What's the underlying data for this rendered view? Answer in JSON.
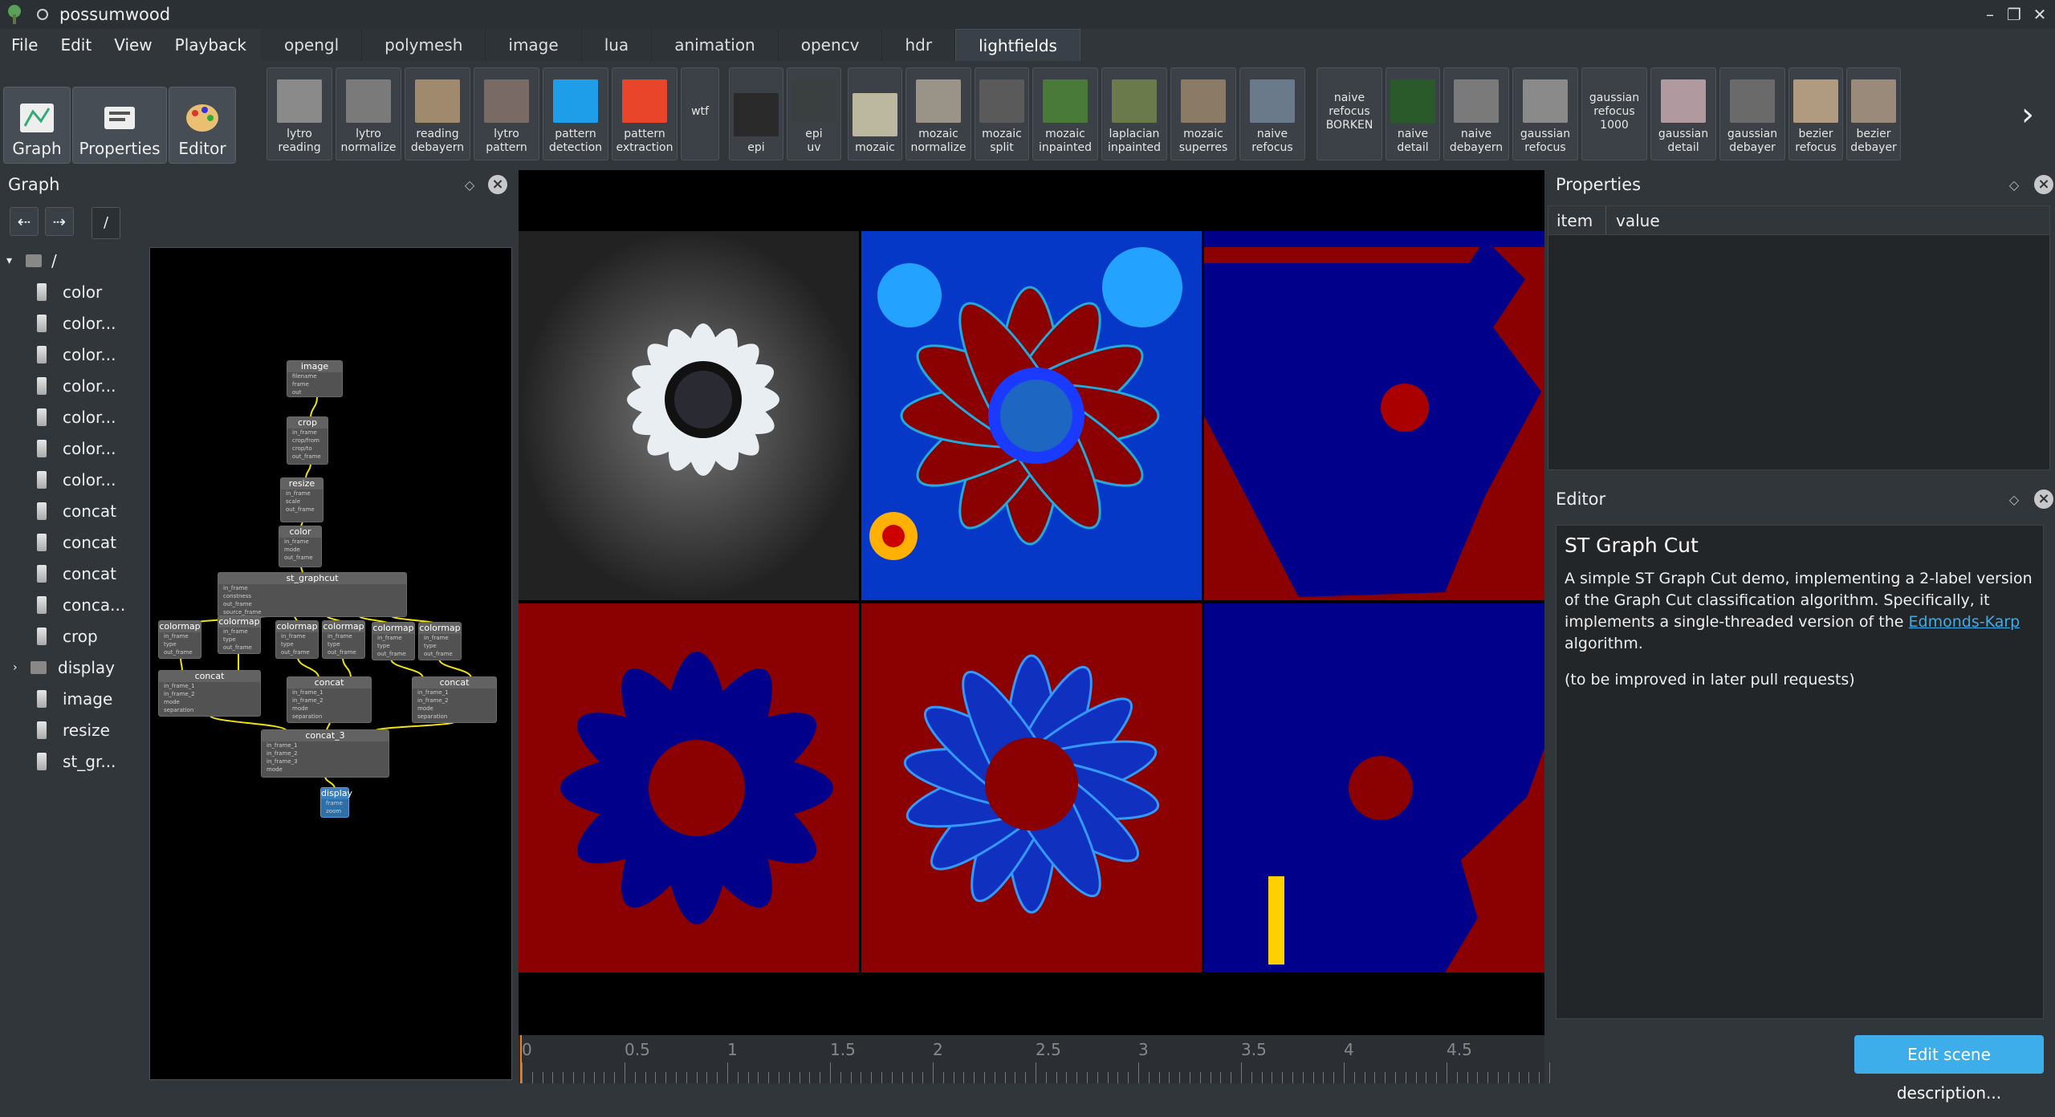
{
  "window": {
    "title": "possumwood"
  },
  "menu": [
    "File",
    "Edit",
    "View",
    "Playback"
  ],
  "tabs": [
    "opengl",
    "polymesh",
    "image",
    "lua",
    "animation",
    "opencv",
    "hdr",
    "lightfields"
  ],
  "active_tab": "lightfields",
  "left_buttons": [
    "Graph",
    "Properties",
    "Editor"
  ],
  "examples": [
    {
      "label": "lytro\nreading",
      "thumb": "#8a8a8a"
    },
    {
      "label": "lytro\nnormalize",
      "thumb": "#7a7a7a"
    },
    {
      "label": "reading\ndebayern",
      "thumb": "#a08a6e"
    },
    {
      "label": "lytro\npattern",
      "thumb": "#7a6a66"
    },
    {
      "label": "pattern\ndetection",
      "thumb": "#1e9ee8"
    },
    {
      "label": "pattern\nextraction",
      "thumb": "#e8452a"
    },
    {
      "label": "wtf",
      "thumb": ""
    },
    {
      "label": "epi",
      "thumb": "#2a2a2a"
    },
    {
      "label": "epi\nuv",
      "thumb": "#3a4040"
    },
    {
      "label": "mozaic",
      "thumb": "#bcb8a0"
    },
    {
      "label": "mozaic\nnormalize",
      "thumb": "#9a9488"
    },
    {
      "label": "mozaic\nsplit",
      "thumb": "#5a5a5a"
    },
    {
      "label": "mozaic\ninpainted",
      "thumb": "#4a7a3a"
    },
    {
      "label": "laplacian\ninpainted",
      "thumb": "#6a7a4a"
    },
    {
      "label": "mozaic\nsuperres",
      "thumb": "#8a7a66"
    },
    {
      "label": "naive\nrefocus",
      "thumb": "#6a7a8a"
    },
    {
      "label": "naive\nrefocus\nBORKEN",
      "thumb": ""
    },
    {
      "label": "naive\ndetail",
      "thumb": "#2a5a2a"
    },
    {
      "label": "naive\ndebayern",
      "thumb": "#7a7a7a"
    },
    {
      "label": "gaussian\nrefocus",
      "thumb": "#8a8a8a"
    },
    {
      "label": "gaussian\nrefocus\n1000",
      "thumb": ""
    },
    {
      "label": "gaussian\ndetail",
      "thumb": "#b09aa0"
    },
    {
      "label": "gaussian\ndebayer",
      "thumb": "#6a6a6a"
    },
    {
      "label": "bezier\nrefocus",
      "thumb": "#b09a80"
    },
    {
      "label": "bezier\ndebayer",
      "thumb": "#9a8a7a"
    }
  ],
  "graph_panel": {
    "title": "Graph",
    "path": "/",
    "tree": [
      "/",
      "color",
      "color...",
      "color...",
      "color...",
      "color...",
      "color...",
      "color...",
      "concat",
      "concat",
      "concat",
      "conca...",
      "crop",
      "display",
      "image",
      "resize",
      "st_gr..."
    ]
  },
  "nodes": {
    "image": {
      "title": "image",
      "ports": [
        "filename",
        "frame",
        "out"
      ]
    },
    "crop": {
      "title": "crop",
      "ports": [
        "in_frame",
        "crop/from",
        "crop/to",
        "out_frame"
      ]
    },
    "resize": {
      "title": "resize",
      "ports": [
        "in_frame",
        "scale",
        "out_frame"
      ]
    },
    "color": {
      "title": "color",
      "ports": [
        "in_frame",
        "mode",
        "out_frame"
      ]
    },
    "graphcut": {
      "title": "st_graphcut",
      "ports": [
        "in_frame",
        "constness",
        "out_frame",
        "source_frame",
        "fsets_frame",
        "sum_frame",
        "sink_frame"
      ]
    },
    "colormap": {
      "title": "colormap",
      "ports": [
        "in_frame",
        "type",
        "out_frame"
      ]
    },
    "concat": {
      "title": "concat",
      "ports": [
        "in_frame_1",
        "in_frame_2",
        "mode",
        "separation",
        "out_frame"
      ]
    },
    "concat3": {
      "title": "concat_3",
      "ports": [
        "in_frame_1",
        "in_frame_2",
        "in_frame_3",
        "mode",
        "separation",
        "out_frame"
      ]
    },
    "display": {
      "title": "display",
      "ports": [
        "frame",
        "zoom"
      ]
    }
  },
  "timeline": {
    "labels": [
      "0",
      "0.5",
      "1",
      "1.5",
      "2",
      "2.5",
      "3",
      "3.5",
      "4",
      "4.5"
    ]
  },
  "properties_panel": {
    "title": "Properties",
    "columns": [
      "item",
      "value"
    ]
  },
  "editor_panel": {
    "title": "Editor",
    "heading": "ST Graph Cut",
    "p1_before": "A simple ST Graph Cut demo, implementing a 2-label version of the Graph Cut classification algorithm. Specifically, it implements a single-threaded version of the ",
    "link": "Edmonds-Karp",
    "p1_after": " algorithm.",
    "p2": "(to be improved in later pull requests)",
    "button": "Edit scene description..."
  },
  "colors": {
    "accent": "#3daee9",
    "bg": "#31363b",
    "dark_red": "#8b0000",
    "dark_blue": "#00008b"
  }
}
